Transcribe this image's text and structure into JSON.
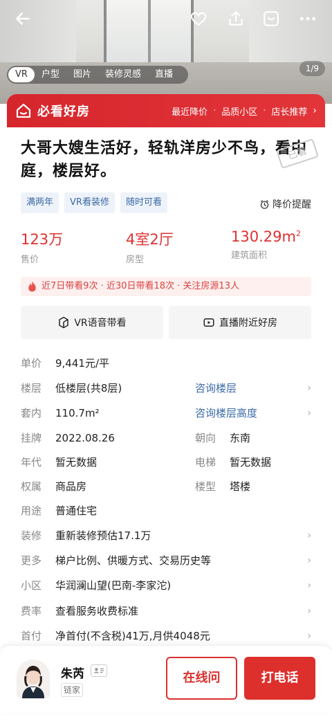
{
  "hero": {
    "media_tabs": [
      "VR",
      "户型",
      "图片",
      "装修灵感",
      "直播"
    ],
    "page_counter": "1/9"
  },
  "banner": {
    "brand": "必看好房",
    "links": [
      "最近降价",
      "品质小区",
      "店长推荐"
    ]
  },
  "listing": {
    "title": "大哥大嫂生活好，轻轨洋房少不鸟，看中庭，楼层好。",
    "stamp": "已看",
    "tags": [
      "满两年",
      "VR看装修",
      "随时可看"
    ],
    "price_alert": "降价提醒",
    "stats": [
      {
        "value": "123万",
        "label": "售价"
      },
      {
        "value": "4室2厅",
        "label": "房型"
      },
      {
        "value": "130.29m",
        "sup": "2",
        "label": "建筑面积"
      }
    ],
    "look_info": "近7日带看9次 · 近30日带看18次 · 关注房源13人",
    "actions": [
      "VR语音带看",
      "直播附近好房"
    ]
  },
  "details": {
    "unit_price": {
      "k": "单价",
      "v": "9,441元/平"
    },
    "floor": {
      "k": "楼层",
      "v": "低楼层(共8层)",
      "link": "咨询楼层"
    },
    "inner": {
      "k": "套内",
      "v": "110.7m²",
      "link": "咨询楼层高度"
    },
    "listed": {
      "k": "挂牌",
      "v": "2022.08.26",
      "k2": "朝向",
      "v2": "东南"
    },
    "year": {
      "k": "年代",
      "v": "暂无数据",
      "k2": "电梯",
      "v2": "暂无数据"
    },
    "ownership": {
      "k": "权属",
      "v": "商品房",
      "k2": "楼型",
      "v2": "塔楼"
    },
    "usage": {
      "k": "用途",
      "v": "普通住宅"
    },
    "decor": {
      "k": "装修",
      "v": "重新装修预估17.1万"
    },
    "more": {
      "k": "更多",
      "v": "梯户比例、供暖方式、交易历史等"
    },
    "community": {
      "k": "小区",
      "v": "华润澜山望(巴南-李家沱)"
    },
    "fee": {
      "k": "费率",
      "v": "查看服务收费标准"
    },
    "down_payment": {
      "k": "首付",
      "v": "净首付(不含税)41万,月供4048元"
    }
  },
  "agent": {
    "name": "朱芮",
    "org": "链家",
    "online_button": "在线问",
    "call_button": "打电话"
  },
  "colors": {
    "brand_red": "#d5262c",
    "link_blue": "#3a6aa8",
    "tag_bg": "#eef3fa"
  }
}
